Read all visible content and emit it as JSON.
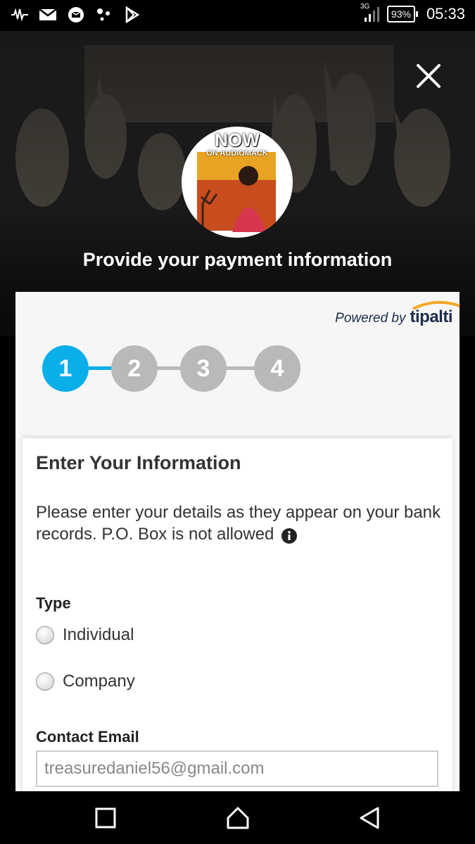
{
  "status_bar": {
    "icons": [
      "activity-icon",
      "gmail-icon",
      "message-icon",
      "dots-icon",
      "play-store-icon"
    ],
    "network": "3G",
    "battery": "93%",
    "time": "05:33"
  },
  "hero": {
    "artwork_text": "NOW",
    "artwork_subtext": "ON AUDIOMACK",
    "title": "Provide your payment information"
  },
  "panel": {
    "powered_by": "Powered by",
    "brand": "tipalti",
    "steps": [
      "1",
      "2",
      "3",
      "4"
    ],
    "active_step": 1
  },
  "form": {
    "title": "Enter Your Information",
    "description": "Please enter your details as they appear on your bank records. P.O. Box is not allowed",
    "type_label": "Type",
    "options": [
      "Individual",
      "Company"
    ],
    "email_label": "Contact Email",
    "email_value": "treasuredaniel56@gmail.com"
  },
  "colors": {
    "accent": "#0aaee9",
    "inactive_step": "#b9b9b9"
  }
}
